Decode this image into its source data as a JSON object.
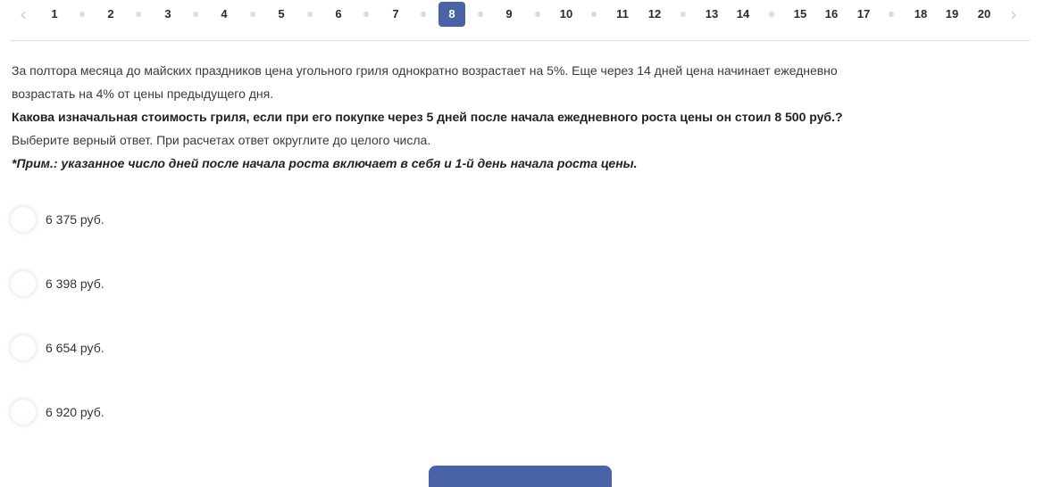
{
  "pagination": {
    "prev_icon": "‹",
    "next_icon": "›",
    "pages": [
      "1",
      "2",
      "3",
      "4",
      "5",
      "6",
      "7",
      "8",
      "9",
      "10",
      "11",
      "12",
      "13",
      "14",
      "15",
      "16",
      "17",
      "18",
      "19",
      "20"
    ],
    "active_page": "8"
  },
  "question": {
    "text_line1": "За полтора месяца до майских праздников цена угольного гриля однократно возрастает на 5%. Еще через 14 дней цена начинает ежедневно",
    "text_line2": "возрастать на 4% от цены предыдущего дня.",
    "prompt": "Какова изначальная стоимость гриля, если при его покупке через 5 дней после начала ежедневного роста цены он стоил 8 500 руб.?",
    "instruction": "Выберите верный ответ. При расчетах ответ округлите до целого числа.",
    "note": "*Прим.: указанное число дней после начала роста включает в себя и 1-й день начала роста цены."
  },
  "answers": [
    {
      "label": "6 375 руб."
    },
    {
      "label": "6 398 руб."
    },
    {
      "label": "6 654 руб."
    },
    {
      "label": "6 920 руб."
    }
  ],
  "colors": {
    "accent": "#4a63a6",
    "divider": "#dedede"
  }
}
